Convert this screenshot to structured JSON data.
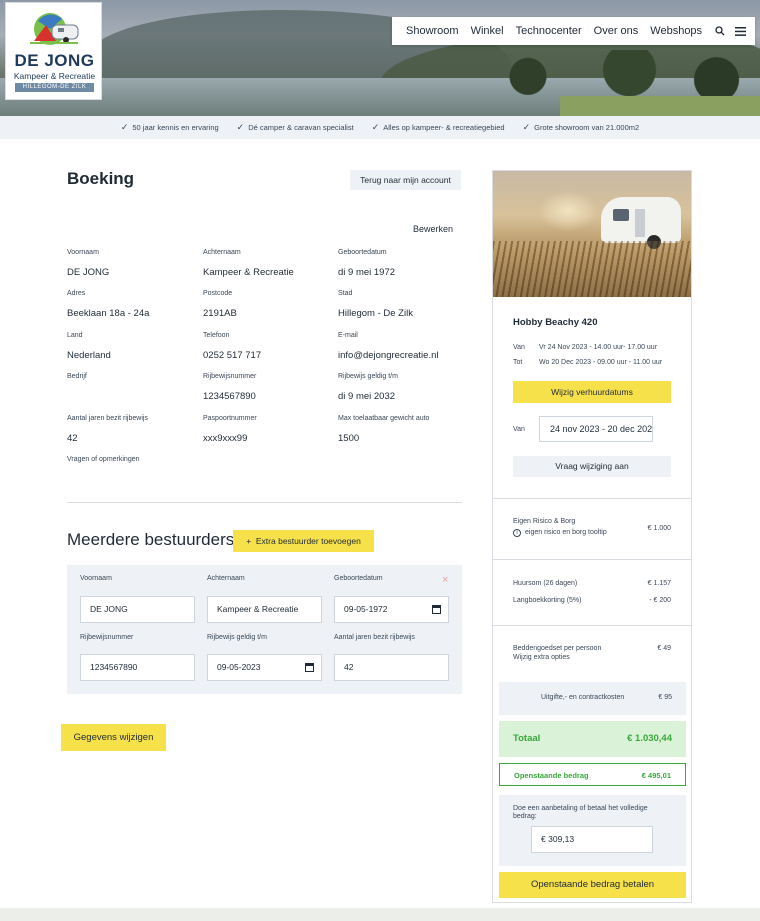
{
  "brand": {
    "name": "DE JONG",
    "tagline": "Kampeer & Recreatie",
    "location": "HILLEGOM-DE ZILK"
  },
  "nav": {
    "items": [
      "Showroom",
      "Winkel",
      "Technocenter",
      "Over ons",
      "Webshops"
    ]
  },
  "usps": [
    "50 jaar kennis en ervaring",
    "Dé camper & caravan specialist",
    "Alles op kampeer- & recreatiegebied",
    "Grote showroom van 21.000m2"
  ],
  "booking": {
    "title": "Boeking",
    "back_label": "Terug naar mijn account",
    "edit_label": "Bewerken",
    "fields": [
      {
        "label": "Voornaam",
        "value": "DE JONG"
      },
      {
        "label": "Achternaam",
        "value": "Kampeer & Recreatie"
      },
      {
        "label": "Geboortedatum",
        "value": "di 9 mei 1972"
      },
      {
        "label": "Adres",
        "value": "Beeklaan 18a - 24a"
      },
      {
        "label": "Postcode",
        "value": "2191AB"
      },
      {
        "label": "Stad",
        "value": "Hillegom - De Zilk"
      },
      {
        "label": "Land",
        "value": "Nederland"
      },
      {
        "label": "Telefoon",
        "value": "0252 517 717"
      },
      {
        "label": "E-mail",
        "value": "info@dejongrecreatie.nl"
      },
      {
        "label": "Bedrijf",
        "value": ""
      },
      {
        "label": "Rijbewijsnummer",
        "value": "1234567890"
      },
      {
        "label": "Rijbewijs geldig t/m",
        "value": "di 9 mei 2032"
      },
      {
        "label": "Aantal jaren bezit rijbewijs",
        "value": "42"
      },
      {
        "label": "Paspoortnummer",
        "value": "xxx9xxx99"
      },
      {
        "label": "Max toelaatbaar gewicht auto",
        "value": "1500"
      },
      {
        "label": "Vragen of opmerkingen",
        "value": ""
      }
    ]
  },
  "drivers": {
    "title": "Meerdere bestuurders?",
    "add_label": "Extra bestuurder toevoegen",
    "close_glyph": "×",
    "fields": [
      {
        "label": "Voornaam",
        "value": "DE JONG"
      },
      {
        "label": "Achternaam",
        "value": "Kampeer & Recreatie"
      },
      {
        "label": "Geboortedatum",
        "value": "09-05-1972"
      },
      {
        "label": "Rijbewijsnummer",
        "value": "1234567890"
      },
      {
        "label": "Rijbewijs geldig t/m",
        "value": "09-05-2023"
      },
      {
        "label": "Aantal jaren bezit rijbewijs",
        "value": "42"
      }
    ]
  },
  "save_label": "Gegevens wijzigen",
  "sidebar": {
    "product": "Hobby Beachy 420",
    "from_label": "Van",
    "from_value": "Vr 24 Nov 2023 - 14.00 uur- 17.00 uur",
    "to_label": "Tot",
    "to_value": "Wo 20 Dec 2023 - 09.00 uur - 11.00 uur",
    "change_dates_label": "Wijzig verhuurdatums",
    "range_label": "Van",
    "range_value": "24 nov 2023 - 20 dec 2023",
    "request_label": "Vraag wijziging aan",
    "risk_label": "Eigen Risico & Borg",
    "risk_tooltip": "eigen risico en borg tooltip",
    "risk_amount": "€ 1.000",
    "rent_label": "Huursom (26 dagen)",
    "rent_amount": "€ 1.157",
    "discount_label": "Langboekkorting (5%)",
    "discount_amount": "- € 200",
    "bedding_label": "Beddengoedset per persoon",
    "bedding_amount": "€ 49",
    "extras_label": "Wijzig extra opties",
    "fees_label": "Uitgifte,- en contractkosten",
    "fees_amount": "€ 95",
    "total_label": "Totaal",
    "total_amount": "€ 1.030,44",
    "open_label": "Openstaande bedrag",
    "open_amount": "€ 495,01",
    "pay_text": "Doe een aanbetaling of betaal het volledige bedrag:",
    "pay_currency": "€",
    "pay_value": "309,13",
    "pay_button": "Openstaande bedrag betalen"
  },
  "colors": {
    "accent_yellow": "#f7e14a",
    "success_green": "#38a83a",
    "panel_blue": "#eef2f6",
    "text_dark": "#1f2a36"
  }
}
